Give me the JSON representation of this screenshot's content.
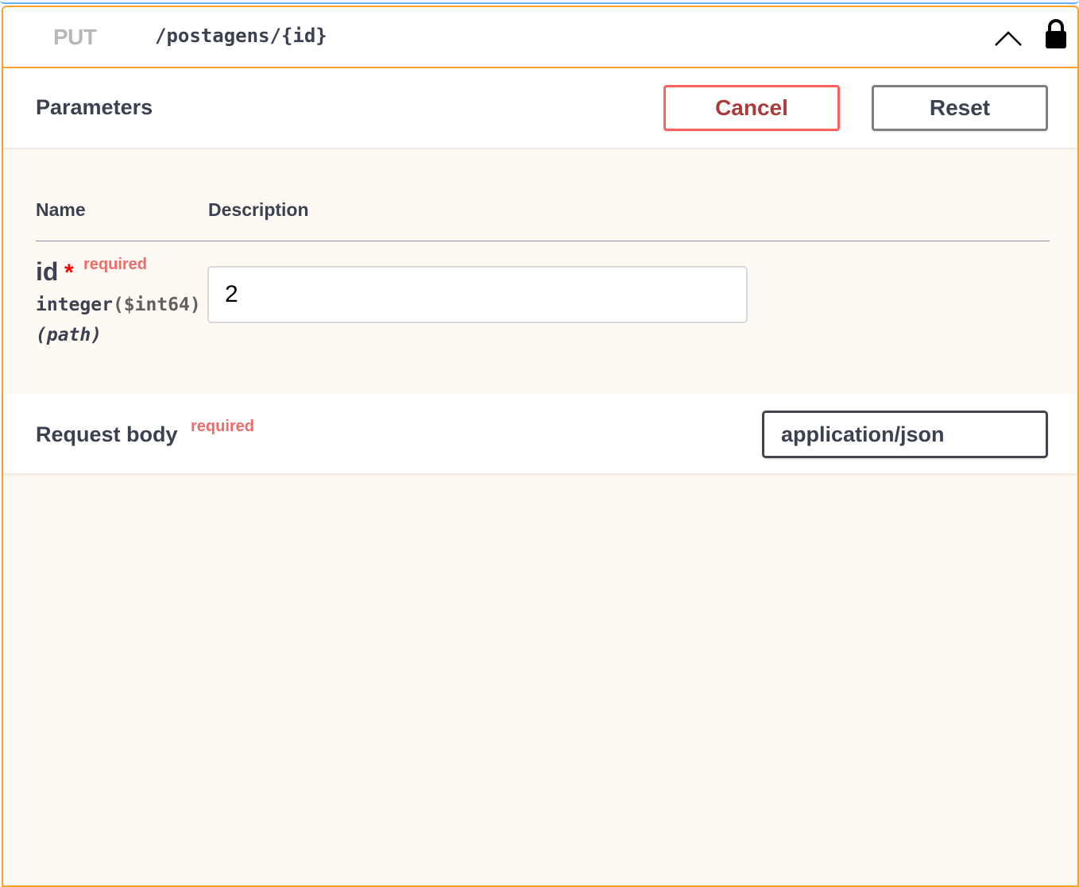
{
  "operation": {
    "method": "PUT",
    "path": "/postagens/{id}",
    "icons": {
      "collapse": "chevron-up-icon",
      "auth": "lock-icon"
    }
  },
  "parameters": {
    "title": "Parameters",
    "cancel_label": "Cancel",
    "reset_label": "Reset",
    "columns": {
      "name": "Name",
      "description": "Description"
    },
    "items": [
      {
        "name": "id",
        "required_marker": "*",
        "required_label": "required",
        "type": "integer",
        "format": "($int64)",
        "in": "(path)",
        "value": "2"
      }
    ]
  },
  "request_body": {
    "title": "Request body",
    "required_label": "required",
    "content_type": "application/json"
  },
  "colors": {
    "put_border": "#fca130",
    "get_border": "#61affe",
    "cancel_border": "#ff6060",
    "required_text": "#f16b6b",
    "required_star": "#ff0000",
    "text": "#3b4151"
  }
}
